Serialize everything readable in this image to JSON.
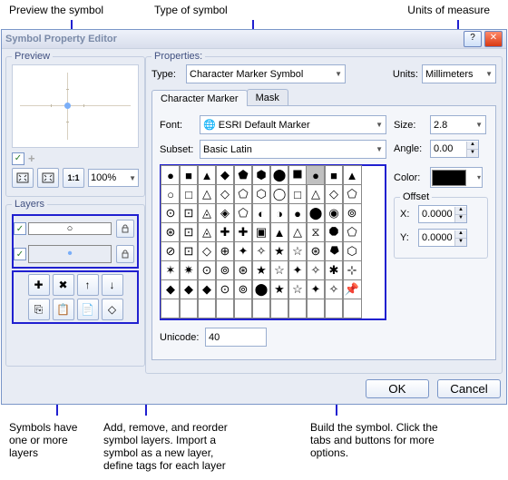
{
  "callouts": {
    "top_left": "Preview the symbol",
    "top_mid": "Type of symbol",
    "top_right": "Units of measure",
    "bot_1": "Symbols have one or more layers",
    "bot_2": "Add, remove, and reorder symbol layers. Import a symbol as a new layer, define tags for each layer",
    "bot_3": "Build the symbol. Click the tabs and buttons for more options."
  },
  "window": {
    "title": "Symbol Property Editor"
  },
  "preview": {
    "legend": "Preview",
    "zoom": "100%"
  },
  "layers": {
    "legend": "Layers",
    "items": [
      {
        "checked": true,
        "glyph": "○",
        "bg": "white"
      },
      {
        "checked": true,
        "glyph": "•",
        "bg": "none",
        "glyph_color": "#7aaef8"
      }
    ]
  },
  "properties": {
    "legend": "Properties:",
    "type_label": "Type:",
    "type_value": "Character Marker Symbol",
    "units_label": "Units:",
    "units_value": "Millimeters",
    "tabs": [
      "Character Marker",
      "Mask"
    ],
    "font_label": "Font:",
    "font_value": "ESRI Default Marker",
    "subset_label": "Subset:",
    "subset_value": "Basic Latin",
    "size_label": "Size:",
    "size_value": "2.8",
    "angle_label": "Angle:",
    "angle_value": "0.00",
    "color_label": "Color:",
    "offset_legend": "Offset",
    "offset_x_label": "X:",
    "offset_x_value": "0.0000",
    "offset_y_label": "Y:",
    "offset_y_value": "0.0000",
    "unicode_label": "Unicode:",
    "unicode_value": "40"
  },
  "buttons": {
    "ok": "OK",
    "cancel": "Cancel"
  },
  "chart_data": {
    "type": "table",
    "note": "11×8 character glyph palette; selected index row0 col8",
    "rows": 8,
    "cols": 11
  }
}
